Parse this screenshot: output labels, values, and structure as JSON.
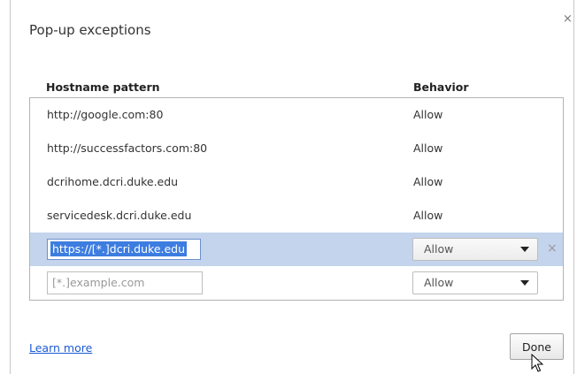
{
  "dialog": {
    "title": "Pop-up exceptions",
    "close_label": "×"
  },
  "table": {
    "headers": {
      "host": "Hostname pattern",
      "behavior": "Behavior"
    },
    "rows": [
      {
        "host": "http://google.com:80",
        "behavior": "Allow"
      },
      {
        "host": "http://successfactors.com:80",
        "behavior": "Allow"
      },
      {
        "host": "dcrihome.dcri.duke.edu",
        "behavior": "Allow"
      },
      {
        "host": "servicedesk.dcri.duke.edu",
        "behavior": "Allow"
      }
    ],
    "editing_row": {
      "host_value": "https://[*.]dcri.duke.edu",
      "behavior": "Allow",
      "remove_label": "×"
    },
    "new_row": {
      "placeholder": "[*.]example.com",
      "behavior": "Allow"
    }
  },
  "footer": {
    "learn_more": "Learn more",
    "done": "Done"
  }
}
